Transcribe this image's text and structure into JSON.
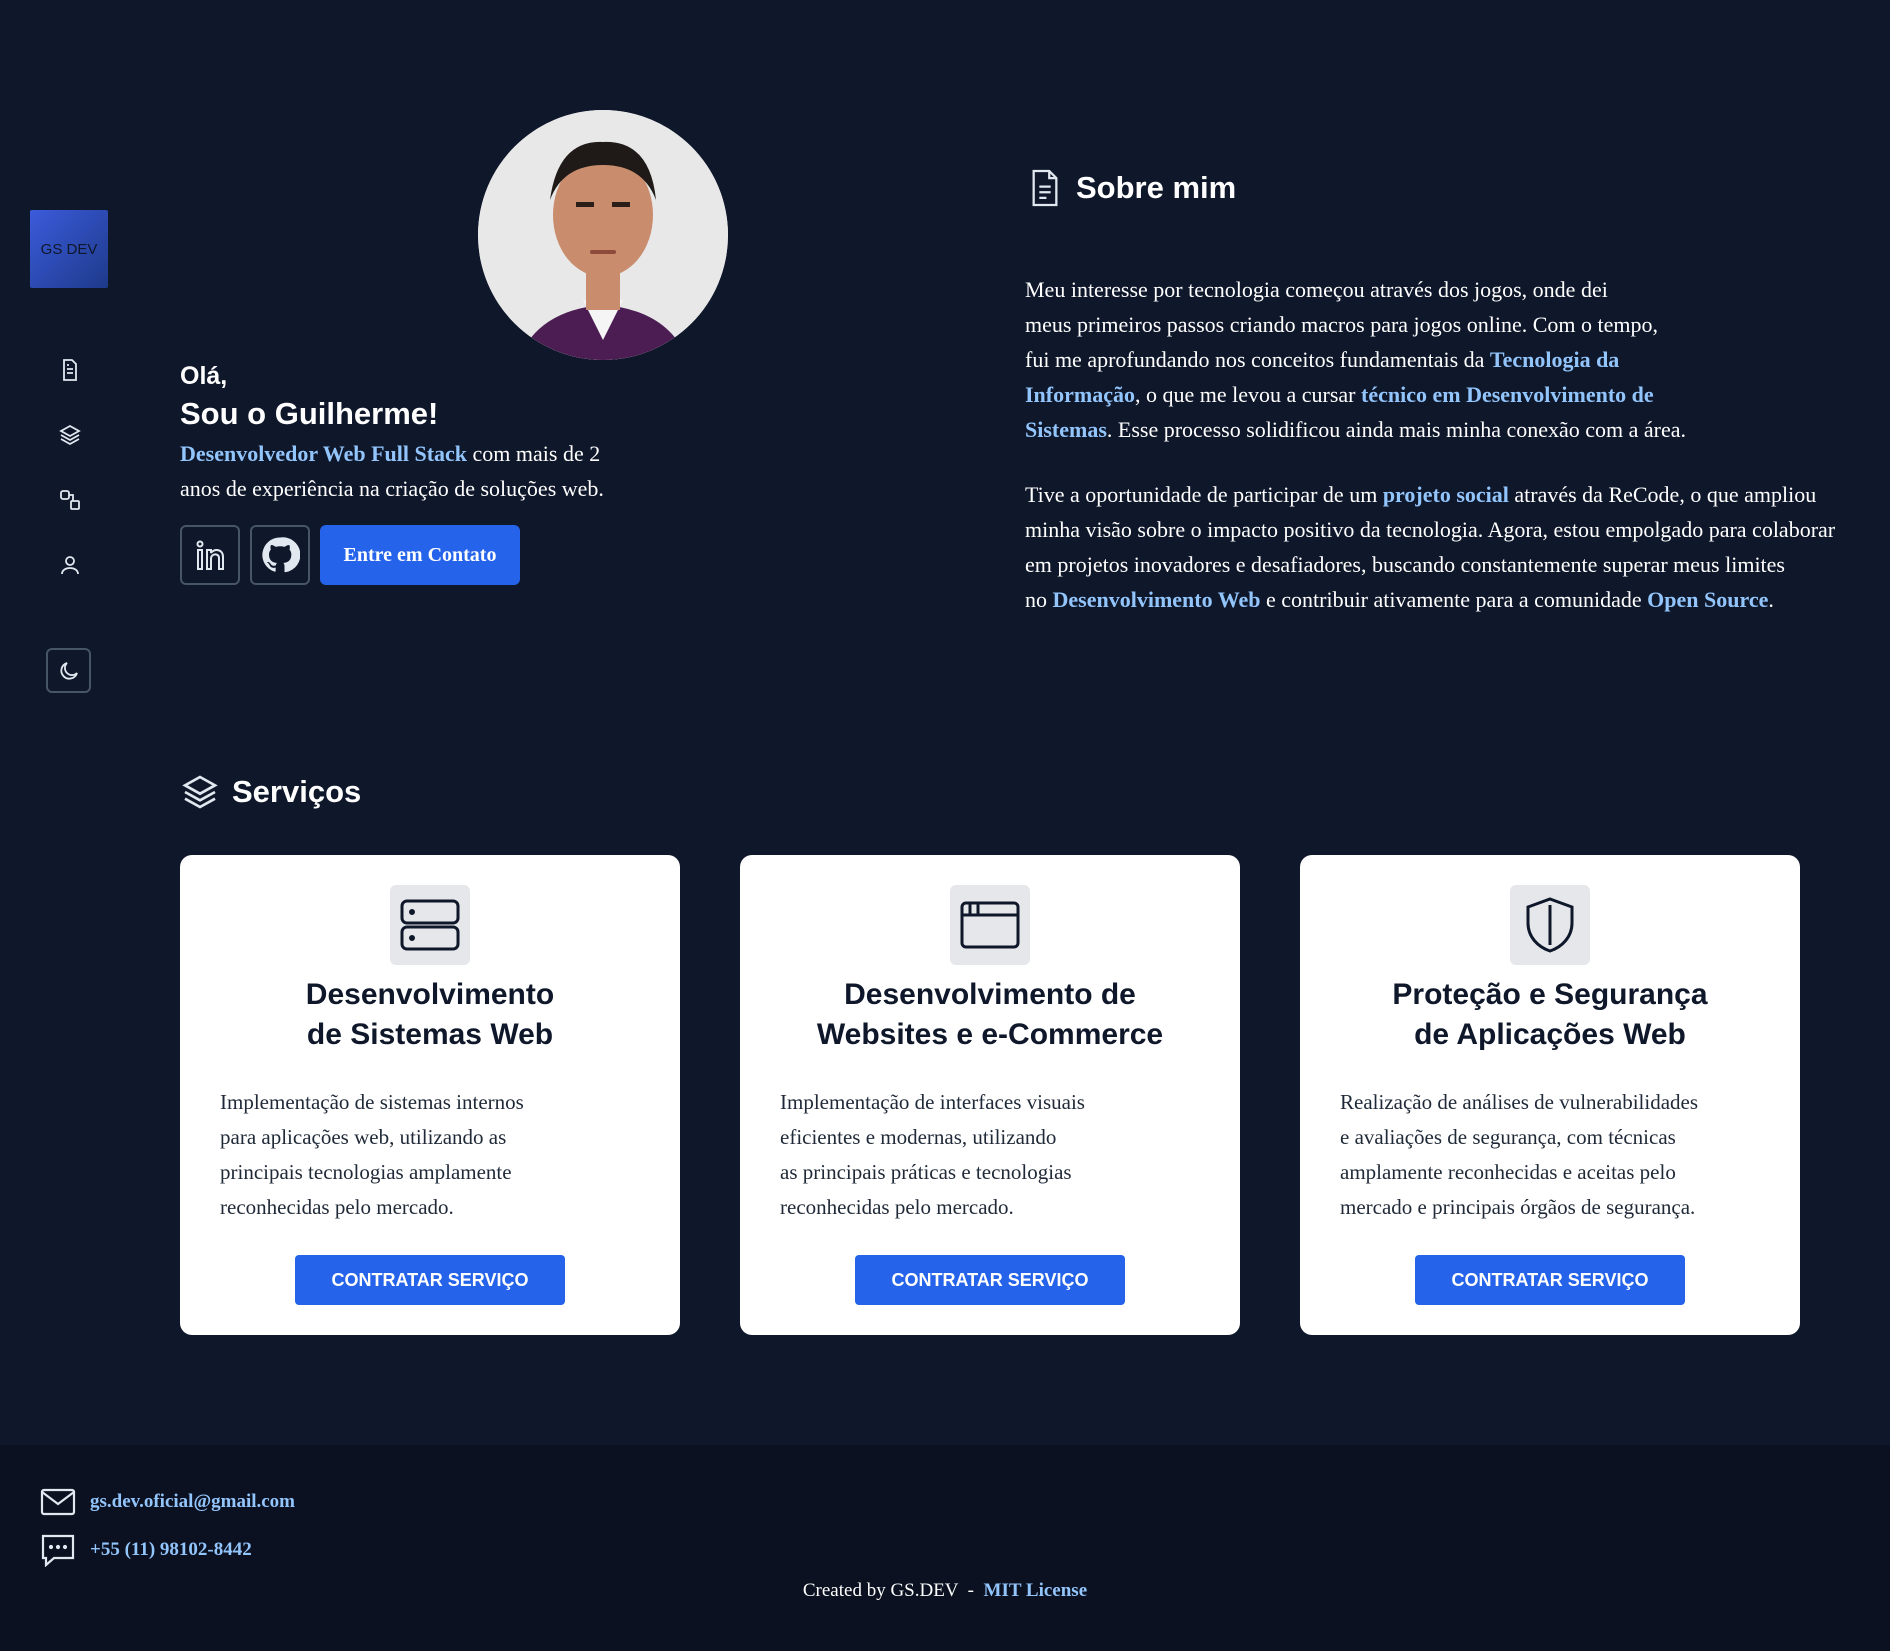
{
  "sidebar": {
    "logo": "GS DEV",
    "nav": [
      "document-icon",
      "layers-icon",
      "shapes-icon",
      "user-icon"
    ],
    "theme_icon": "moon-icon"
  },
  "hero": {
    "greeting": "Olá,",
    "name": "Sou o Guilherme!",
    "role_highlight": "Desenvolvedor Web Full Stack",
    "role_rest": " com mais de 2",
    "role_line2": "anos de experiência na criação de soluções web.",
    "contact_button": "Entre em Contato",
    "social": [
      "linkedin-icon",
      "github-icon"
    ]
  },
  "about": {
    "title": "Sobre mim",
    "p1": {
      "l1": "Meu interesse por tecnologia começou através dos jogos, onde dei",
      "l2": "meus primeiros passos criando macros para jogos online. Com o tempo,",
      "l3a": "fui me aprofundando nos conceitos fundamentais da ",
      "l3b": "Tecnologia da",
      "l4a": "Informação",
      "l4b": ", o que me levou a cursar ",
      "l4c": "técnico em Desenvolvimento de",
      "l5a": "Sistemas",
      "l5b": ". Esse processo solidificou ainda mais minha conexão com a área."
    },
    "p2": {
      "l1a": "Tive a oportunidade de participar de um ",
      "l1b": "projeto social",
      "l1c": " através da ReCode, o que ampliou",
      "l2": "minha visão sobre o impacto positivo da tecnologia. Agora, estou empolgado para colaborar",
      "l3": "em projetos inovadores e desafiadores, buscando constantemente superar meus limites",
      "l4a": "no ",
      "l4b": "Desenvolvimento Web",
      "l4c": " e contribuir ativamente para a comunidade ",
      "l4d": "Open Source",
      "l4e": "."
    }
  },
  "services": {
    "title": "Serviços",
    "cards": [
      {
        "icon": "server-icon",
        "title": "Desenvolvimento\nde Sistemas Web",
        "desc": "Implementação de sistemas internos\npara aplicações web, utilizando as\nprincipais tecnologias amplamente\nreconhecidas pelo mercado.",
        "button": "CONTRATAR SERVIÇO"
      },
      {
        "icon": "browser-window-icon",
        "title": "Desenvolvimento de\nWebsites e e-Commerce",
        "desc": "Implementação de interfaces visuais\neficientes e modernas, utilizando\nas principais práticas e tecnologias\nreconhecidas pelo mercado.",
        "button": "CONTRATAR SERVIÇO"
      },
      {
        "icon": "shield-icon",
        "title": "Proteção e Segurança\nde Aplicações Web",
        "desc": "Realização de análises de vulnerabilidades\ne avaliações de segurança, com técnicas\namplamente reconhecidas e aceitas pelo\nmercado e principais órgãos de segurança.",
        "button": "CONTRATAR SERVIÇO"
      }
    ]
  },
  "footer": {
    "email": "gs.dev.oficial@gmail.com",
    "phone": "+55 (11) 98102-8442",
    "credit": "Created by GS.DEV  -  ",
    "license": "MIT License"
  }
}
